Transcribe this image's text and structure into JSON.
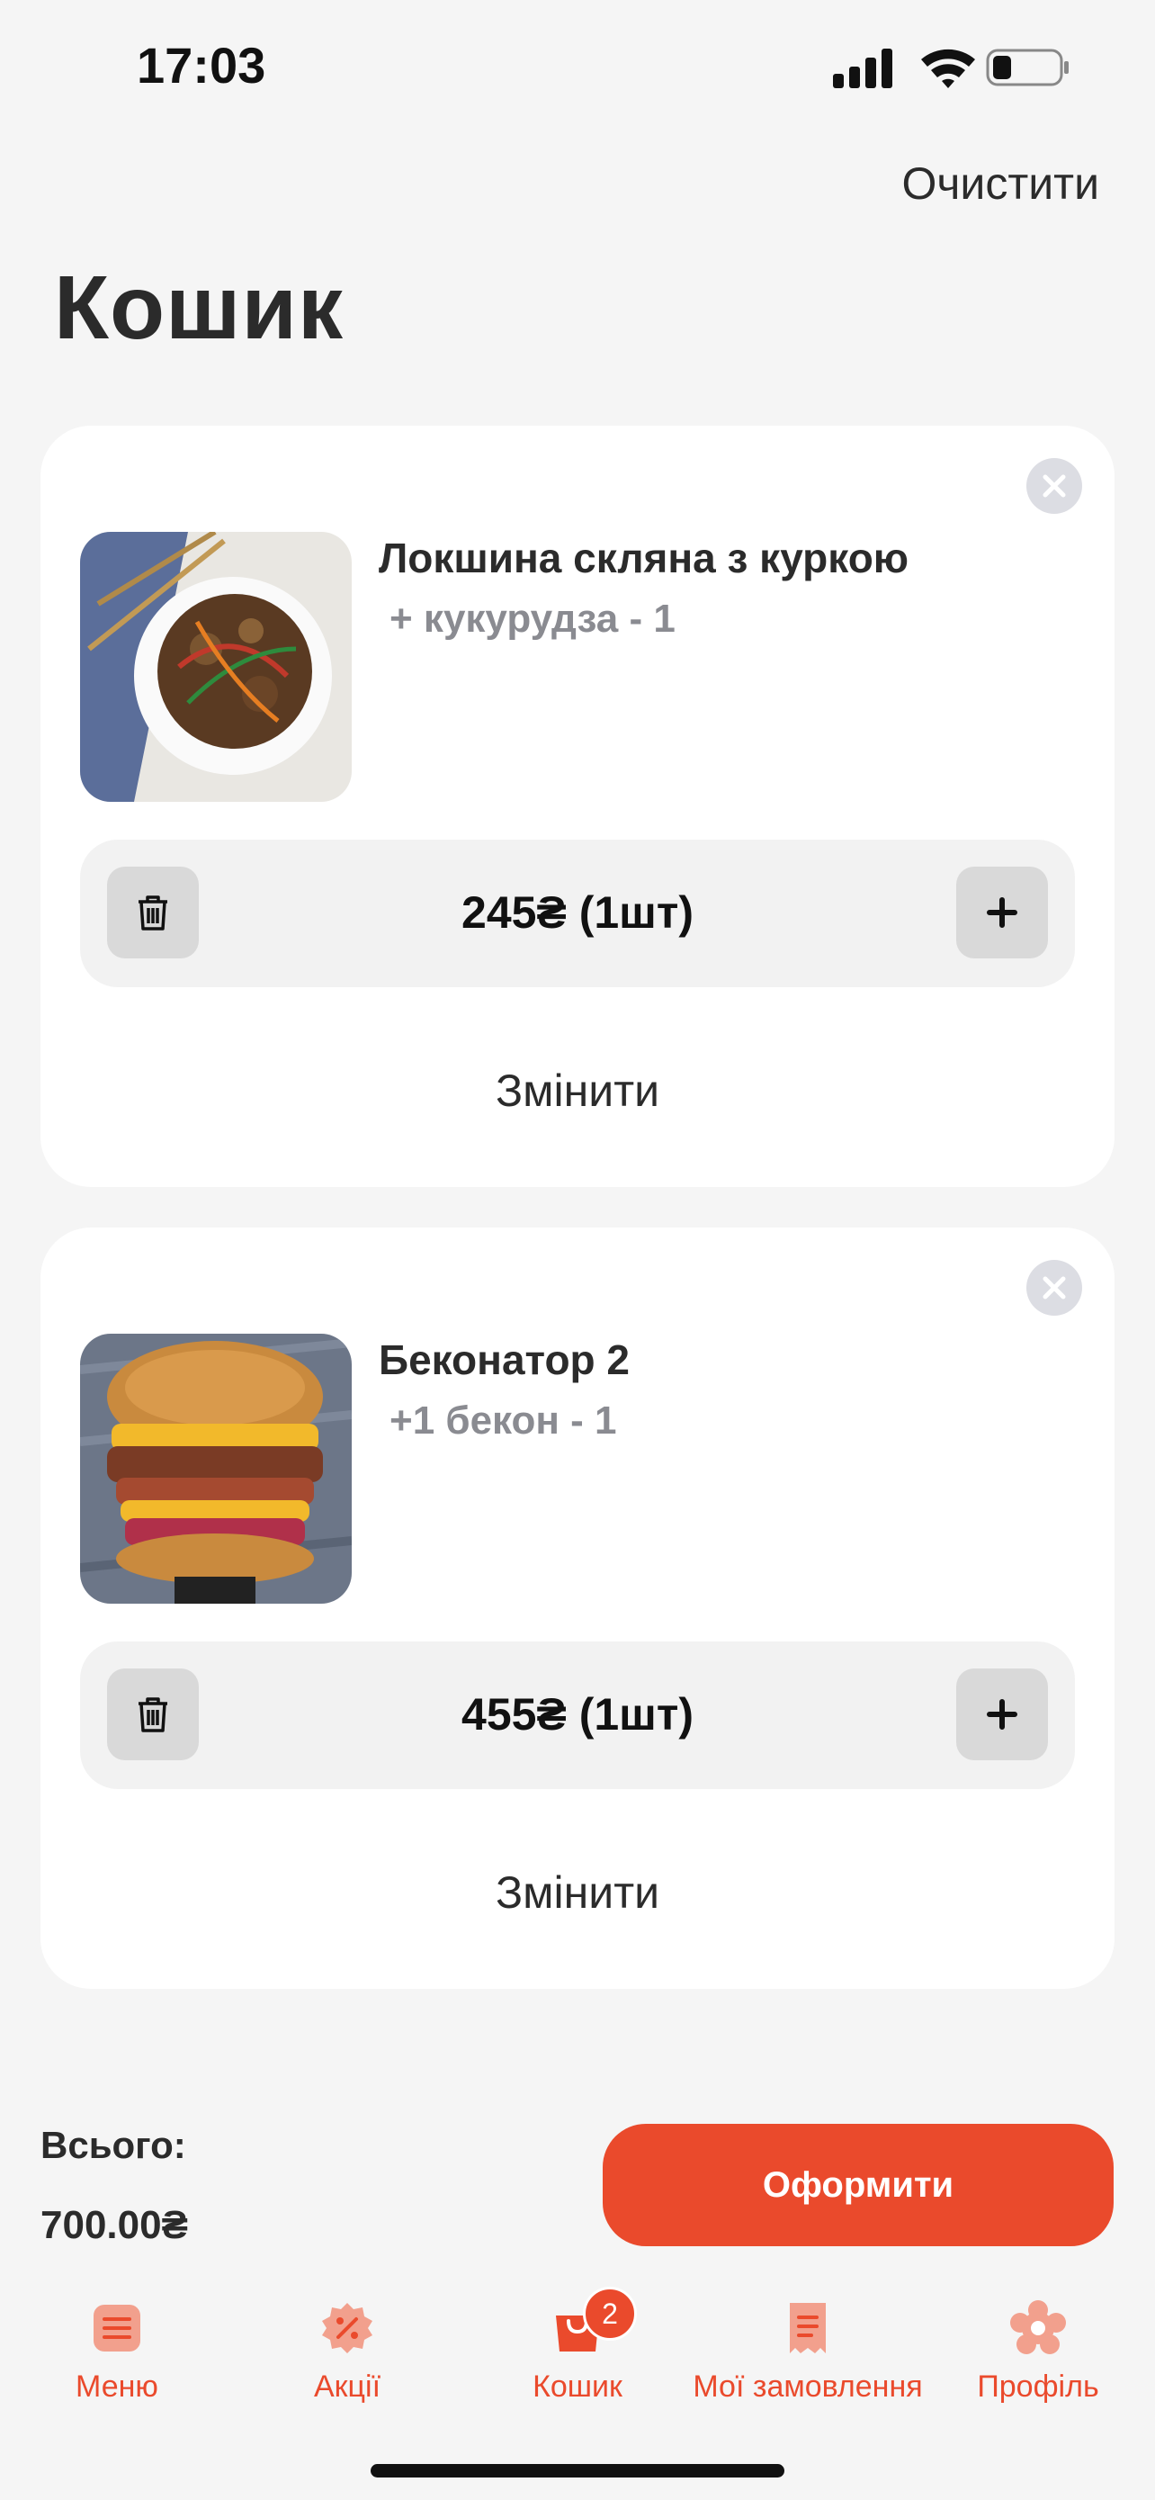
{
  "status_bar": {
    "time": "17:03"
  },
  "header": {
    "clear_label": "Очистити",
    "title": "Кошик"
  },
  "cart_items": [
    {
      "name": "Локшина скляна з куркою",
      "modifier": "+ кукурудза - 1",
      "price_text": "245₴  (1шт)",
      "edit_label": "Змінити"
    },
    {
      "name": "Беконатор 2",
      "modifier": "+1 бекон - 1",
      "price_text": "455₴  (1шт)",
      "edit_label": "Змінити"
    }
  ],
  "footer": {
    "total_label": "Всього:",
    "total_value": "700.00₴",
    "checkout_label": "Оформити"
  },
  "tab_bar": {
    "accent_color": "#ea4a2c",
    "cart_badge": "2",
    "tabs": [
      {
        "label": "Меню",
        "icon": "menu-icon"
      },
      {
        "label": "Акції",
        "icon": "discount-icon"
      },
      {
        "label": "Кошик",
        "icon": "bag-icon"
      },
      {
        "label": "Мої замовлення",
        "icon": "receipt-icon"
      },
      {
        "label": "Профіль",
        "icon": "profile-icon"
      }
    ]
  }
}
